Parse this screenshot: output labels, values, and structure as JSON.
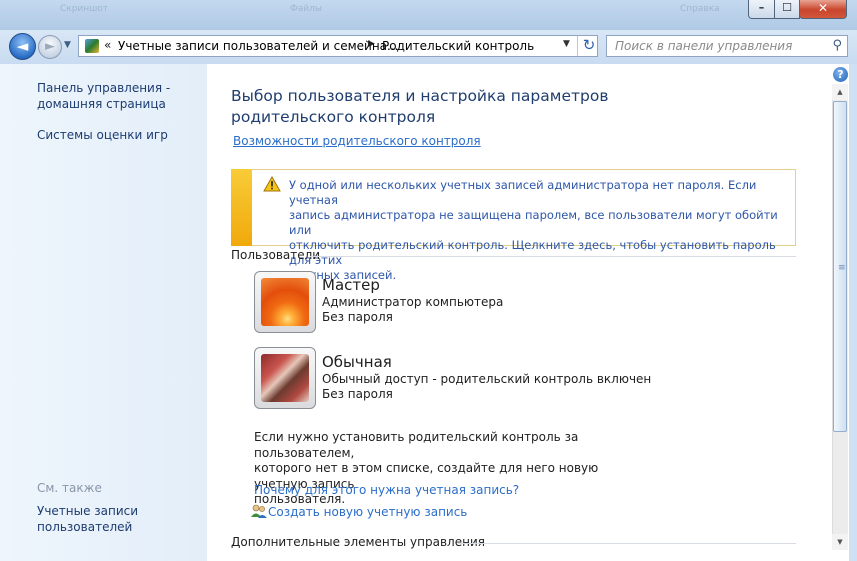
{
  "window": {
    "minimize_glyph": "–",
    "maximize_glyph": "☐",
    "close_glyph": "✕",
    "ghost_labels": [
      "Скриншот",
      "Файлы",
      "Справка"
    ]
  },
  "nav": {
    "back_glyph": "◄",
    "forward_glyph": "►",
    "history_glyph": "▼",
    "address": {
      "chevron": "«",
      "crumb1": "Учетные записи пользователей и семейна...",
      "separator": "▶",
      "crumb2": "Родительский контроль",
      "dropdown_glyph": "▼"
    },
    "refresh_glyph": "↻",
    "search_placeholder": "Поиск в панели управления",
    "search_icon": "⚲"
  },
  "sidebar": {
    "home_line1": "Панель управления -",
    "home_line2": "домашняя страница",
    "games": "Системы оценки игр",
    "see_also": "См. также",
    "accounts_line1": "Учетные записи",
    "accounts_line2": "пользователей"
  },
  "main": {
    "title_line1": "Выбор пользователя и настройка параметров",
    "title_line2": "родительского контроля",
    "features_link": "Возможности родительского контроля",
    "warning": {
      "line1": "У одной или нескольких учетных записей администратора нет пароля. Если учетная",
      "line2": "запись администратора не защищена паролем, все пользователи могут обойти или",
      "line3": "отключить родительский контроль. Щелкните здесь, чтобы установить пароль для этих",
      "line4": "учетных записей."
    },
    "users_heading": "Пользователи",
    "users": [
      {
        "name": "Мастер",
        "role": "Администратор компьютера",
        "password": "Без пароля"
      },
      {
        "name": "Обычная",
        "role": "Обычный доступ - родительский контроль включен",
        "password": "Без пароля"
      }
    ],
    "note_line1": "Если нужно установить родительский контроль за пользователем,",
    "note_line2": "которого нет в этом списке, создайте для него новую учетную запись",
    "note_line3": "пользователя.",
    "why_link": "Почему для этого нужна учетная запись?",
    "create_link": "Создать новую учетную запись",
    "more_heading": "Дополнительные элементы управления"
  },
  "help_glyph": "?",
  "scrollbar": {
    "up_glyph": "▲",
    "down_glyph": "▼",
    "grip_glyph": "≡"
  },
  "colors": {
    "link": "#2b6ec9",
    "heading": "#1f3d6e",
    "warning_bar": "#f0a90b"
  }
}
